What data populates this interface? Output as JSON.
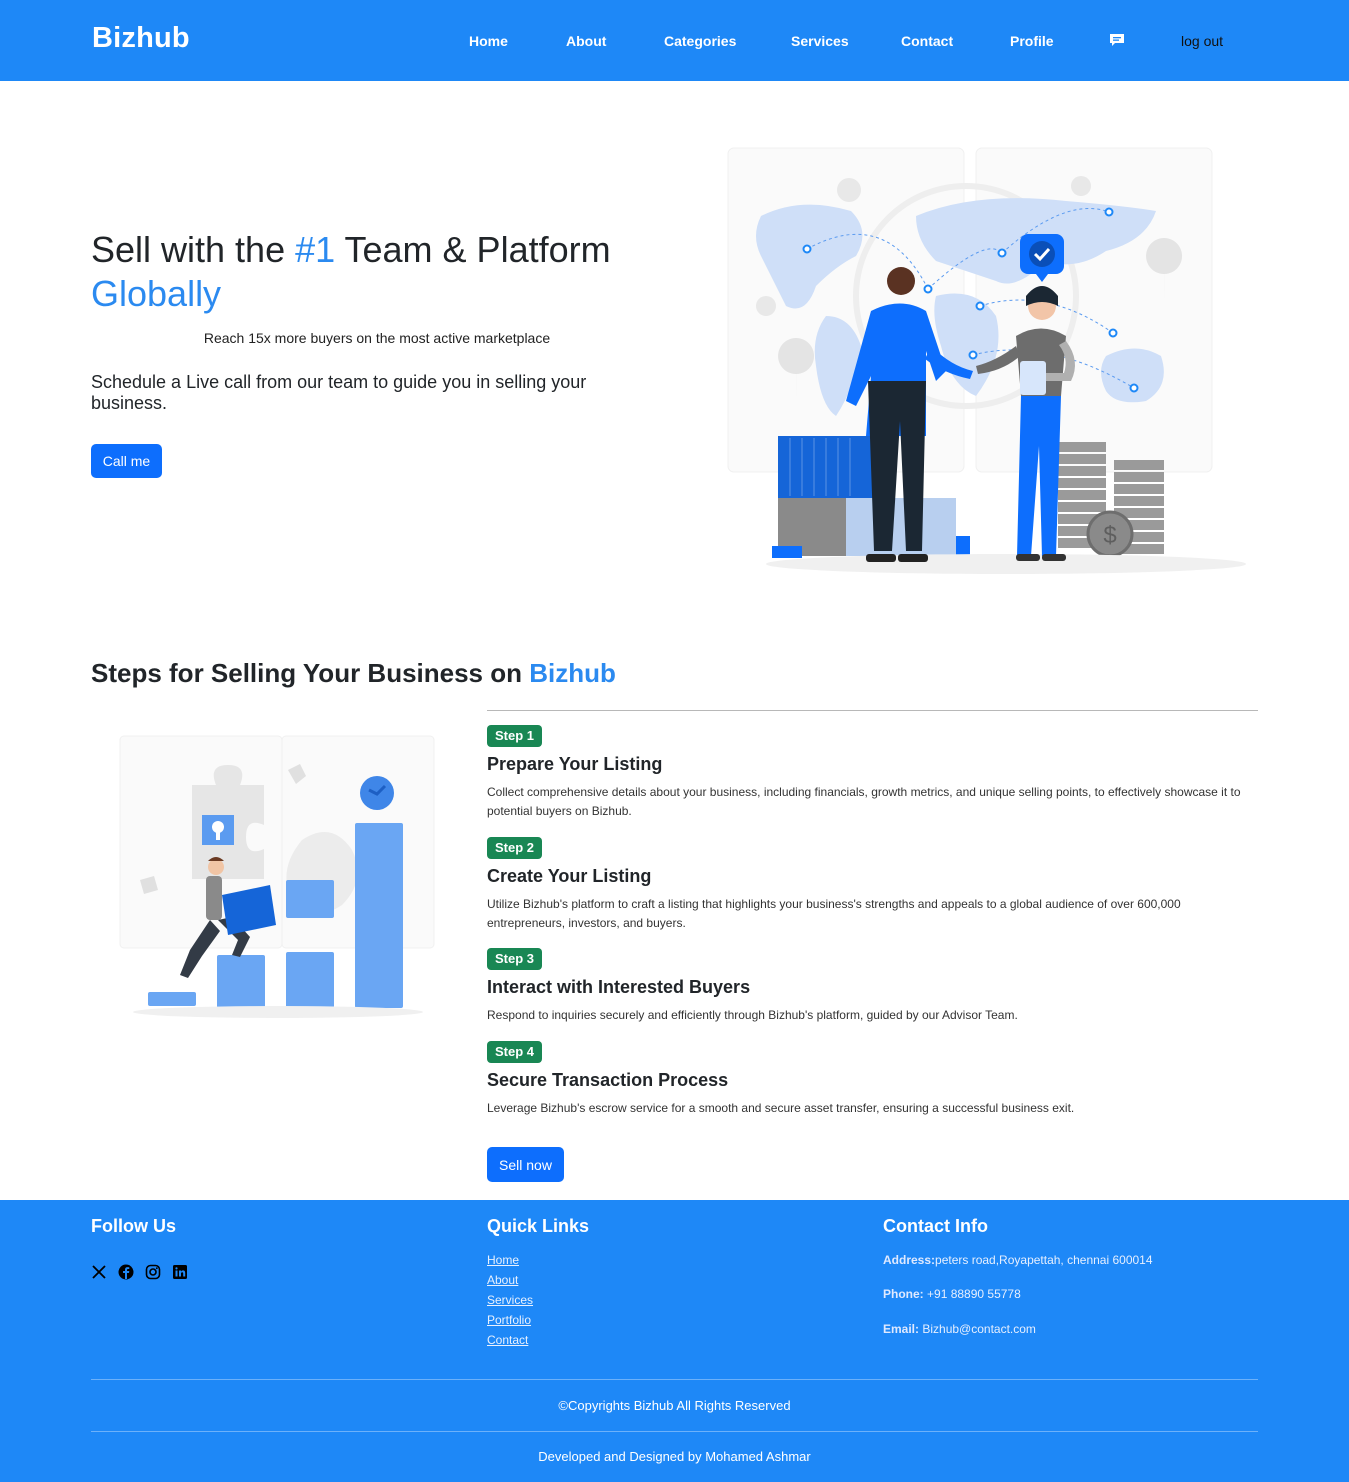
{
  "nav": {
    "brand": "Bizhub",
    "links": [
      "Home",
      "About",
      "Categories",
      "Services",
      "Contact",
      "Profile"
    ],
    "chat_icon": "chat-icon",
    "logout": "log out"
  },
  "hero": {
    "title_part1": "Sell with the ",
    "title_accent1": "#1",
    "title_part2": " Team & Platform",
    "title_accent2": "Globally",
    "subtitle": "Reach 15x more buyers on the most active marketplace",
    "description": "Schedule a Live call from our team to guide you in selling your business.",
    "cta": "Call me"
  },
  "steps_section": {
    "title_part1": "Steps for Selling Your Business on ",
    "title_accent": "Bizhub",
    "steps": [
      {
        "badge": "Step 1",
        "heading": "Prepare Your Listing",
        "text": "Collect comprehensive details about your business, including financials, growth metrics, and unique selling points, to effectively showcase it to potential buyers on Bizhub."
      },
      {
        "badge": "Step 2",
        "heading": "Create Your Listing",
        "text": "Utilize Bizhub's platform to craft a listing that highlights your business's strengths and appeals to a global audience of over 600,000 entrepreneurs, investors, and buyers."
      },
      {
        "badge": "Step 3",
        "heading": "Interact with Interested Buyers",
        "text": "Respond to inquiries securely and efficiently through Bizhub's platform, guided by our Advisor Team."
      },
      {
        "badge": "Step 4",
        "heading": "Secure Transaction Process",
        "text": "Leverage Bizhub's escrow service for a smooth and secure asset transfer, ensuring a successful business exit."
      }
    ],
    "cta": "Sell now"
  },
  "footer": {
    "follow_title": "Follow Us",
    "social_icons": [
      "x-icon",
      "facebook-icon",
      "instagram-icon",
      "linkedin-icon"
    ],
    "quick_title": "Quick Links",
    "quick_links": [
      "Home",
      "About",
      "Services",
      "Portfolio",
      "Contact"
    ],
    "contact_title": "Contact Info",
    "address_label": "Address:",
    "address": "peters road,Royapettah, chennai 600014",
    "phone_label": "Phone:",
    "phone": " +91 88890 55778",
    "email_label": "Email:",
    "email": " Bizhub@contact.com",
    "copyright": "©Copyrights Bizhub All Rights Reserved",
    "credits": "Developed and Designed by Mohamed Ashmar"
  },
  "colors": {
    "brand_blue": "#1e88f7",
    "accent_text": "#2b8af0",
    "button_blue": "#0d6efd",
    "badge_green": "#198754"
  }
}
